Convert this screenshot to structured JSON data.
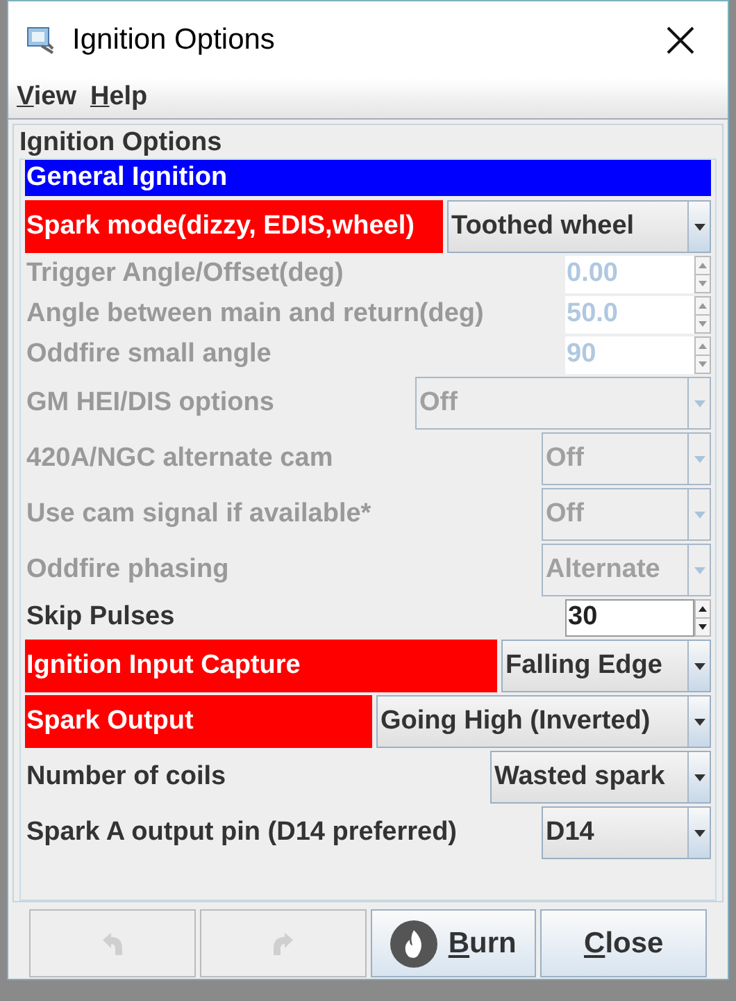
{
  "window": {
    "title": "Ignition Options"
  },
  "menu": [
    {
      "label": "View",
      "mnemonic_underlined": true
    },
    {
      "label": "Help",
      "mnemonic_underlined": true
    }
  ],
  "panel": {
    "title": "Ignition Options",
    "section": "General Ignition",
    "rows": [
      {
        "kind": "combo",
        "label": "Spark mode(dizzy, EDIS,wheel)",
        "value": "Toothed wheel",
        "highlighted": true,
        "disabled": false
      },
      {
        "kind": "spinner",
        "label": "Trigger Angle/Offset(deg)",
        "value": "0.00",
        "highlighted": false,
        "disabled": true
      },
      {
        "kind": "spinner",
        "label": "Angle between main and return(deg)",
        "value": "50.0",
        "highlighted": false,
        "disabled": true
      },
      {
        "kind": "spinner",
        "label": "Oddfire small angle",
        "value": "90",
        "highlighted": false,
        "disabled": true
      },
      {
        "kind": "combo",
        "label": "GM HEI/DIS options",
        "value": "Off",
        "highlighted": false,
        "disabled": true
      },
      {
        "kind": "combo",
        "label": "420A/NGC alternate cam",
        "value": "Off",
        "highlighted": false,
        "disabled": true
      },
      {
        "kind": "combo",
        "label": "Use cam signal if available*",
        "value": "Off",
        "highlighted": false,
        "disabled": true
      },
      {
        "kind": "combo",
        "label": "Oddfire phasing",
        "value": "Alternate",
        "highlighted": false,
        "disabled": true
      },
      {
        "kind": "spinner",
        "label": "Skip Pulses",
        "value": "30",
        "highlighted": false,
        "disabled": false
      },
      {
        "kind": "combo",
        "label": "Ignition Input Capture",
        "value": "Falling Edge",
        "highlighted": true,
        "disabled": false
      },
      {
        "kind": "combo",
        "label": "Spark Output",
        "value": "Going High (Inverted)",
        "highlighted": true,
        "disabled": false
      },
      {
        "kind": "combo",
        "label": "Number of coils",
        "value": "Wasted spark",
        "highlighted": false,
        "disabled": false
      },
      {
        "kind": "combo",
        "label": "Spark A output pin (D14 preferred)",
        "value": "D14",
        "highlighted": false,
        "disabled": false
      }
    ]
  },
  "buttons": [
    {
      "kind": "undo",
      "disabled": true
    },
    {
      "kind": "redo",
      "disabled": true
    },
    {
      "kind": "burn",
      "label": "Burn",
      "mnemonic_underlined": true,
      "disabled": false
    },
    {
      "kind": "close",
      "label": "Close",
      "mnemonic_underlined": true,
      "disabled": false
    }
  ]
}
